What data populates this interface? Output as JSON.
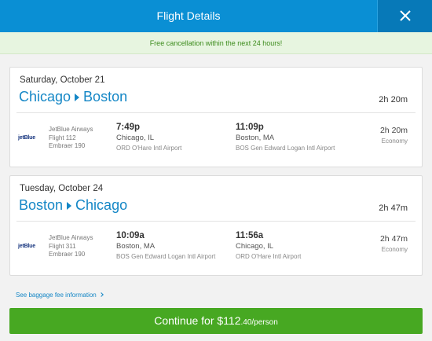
{
  "header": {
    "title": "Flight Details"
  },
  "notice": {
    "text": "Free cancellation within the next 24 hours!"
  },
  "legs": [
    {
      "date": "Saturday, October 21",
      "origin": "Chicago",
      "destination": "Boston",
      "total_duration": "2h 20m",
      "airline_logo": "jetBlue",
      "airline": "JetBlue Airways",
      "flight": "Flight 112",
      "aircraft": "Embraer 190",
      "depart_time": "7:49p",
      "depart_city": "Chicago, IL",
      "depart_airport": "ORD O'Hare Intl Airport",
      "arrive_time": "11:09p",
      "arrive_city": "Boston, MA",
      "arrive_airport": "BOS Gen Edward Logan Intl Airport",
      "segment_duration": "2h 20m",
      "cabin": "Economy"
    },
    {
      "date": "Tuesday, October 24",
      "origin": "Boston",
      "destination": "Chicago",
      "total_duration": "2h 47m",
      "airline_logo": "jetBlue",
      "airline": "JetBlue Airways",
      "flight": "Flight 311",
      "aircraft": "Embraer 190",
      "depart_time": "10:09a",
      "depart_city": "Boston, MA",
      "depart_airport": "BOS Gen Edward Logan Intl Airport",
      "arrive_time": "11:56a",
      "arrive_city": "Chicago, IL",
      "arrive_airport": "ORD O'Hare Intl Airport",
      "segment_duration": "2h 47m",
      "cabin": "Economy"
    }
  ],
  "baggage": {
    "label": "See baggage fee information"
  },
  "continue": {
    "label": "Continue for ",
    "price_main": "$112",
    "price_cents": ".40",
    "per": "/person"
  },
  "colors": {
    "header": "#0a8fd4",
    "accent": "#1587c6",
    "notice_bg": "#e7f5e0",
    "notice_text": "#3b8b1b",
    "continue_bg": "#47a822"
  },
  "icons": {
    "close": "close-icon",
    "route_arrow": "triangle-right-icon",
    "baggage_chevron": "chevron-right-icon"
  }
}
